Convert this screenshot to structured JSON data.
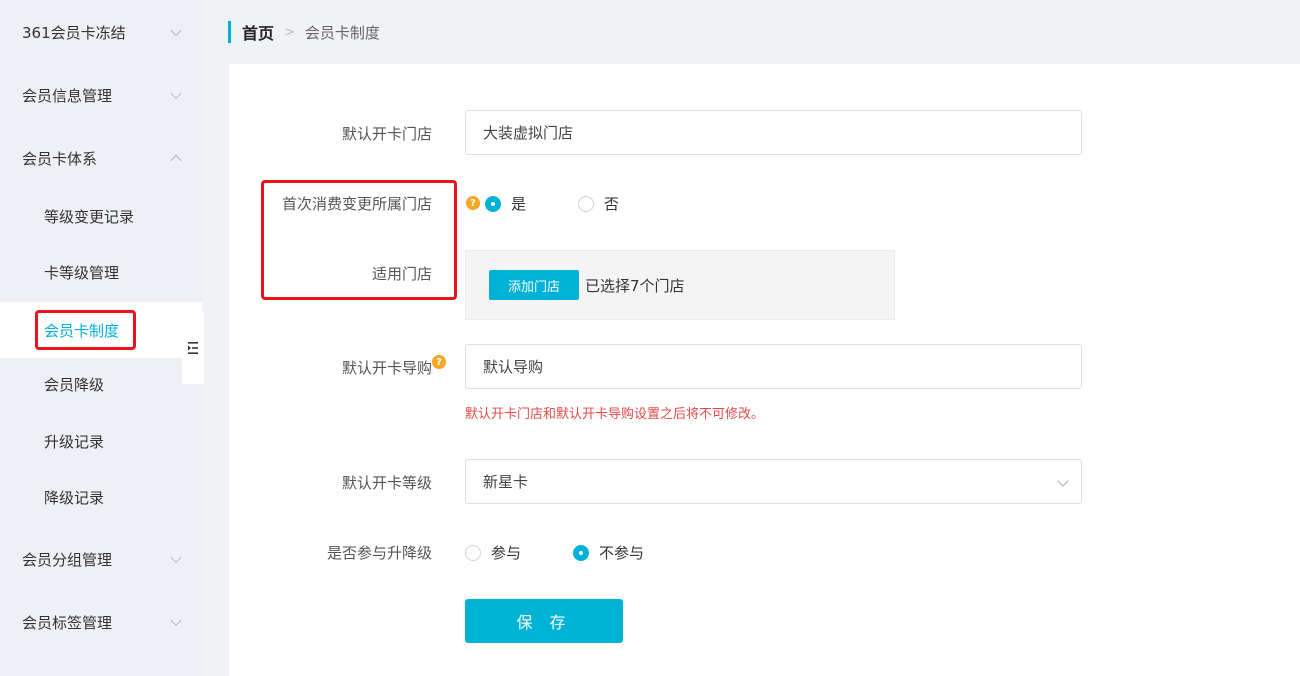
{
  "sidebar": {
    "groups": [
      {
        "label": "361会员卡冻结"
      },
      {
        "label": "会员信息管理"
      },
      {
        "label": "会员卡体系"
      },
      {
        "label": "会员分组管理"
      },
      {
        "label": "会员标签管理"
      }
    ],
    "items": [
      {
        "label": "等级变更记录"
      },
      {
        "label": "卡等级管理"
      },
      {
        "label": "会员卡制度"
      },
      {
        "label": "会员降级"
      },
      {
        "label": "升级记录"
      },
      {
        "label": "降级记录"
      }
    ]
  },
  "breadcrumb": {
    "home": "首页",
    "current": "会员卡制度"
  },
  "form": {
    "default_store": {
      "label": "默认开卡门店",
      "value": "大装虚拟门店"
    },
    "first_consume": {
      "label": "首次消费变更所属门店",
      "yes": "是",
      "no": "否",
      "selected": "yes"
    },
    "applicable_store": {
      "label": "适用门店",
      "add_button": "添加门店",
      "selected_text": "已选择7个门店"
    },
    "default_guide": {
      "label": "默认开卡导购",
      "placeholder": "默认导购",
      "warning": "默认开卡门店和默认开卡导购设置之后将不可修改。"
    },
    "default_level": {
      "label": "默认开卡等级",
      "value": "新星卡"
    },
    "upgrade": {
      "label": "是否参与升降级",
      "yes": "参与",
      "no": "不参与",
      "selected": "no"
    },
    "save_label": "保 存"
  },
  "colors": {
    "accent": "#00b3d6",
    "highlight": "#e8141b",
    "warning": "#e64a4a",
    "help": "#f5a623"
  },
  "icons": {
    "help": "question-circle-icon",
    "chevron": "chevron-down-icon",
    "collapse": "menu-collapse-icon"
  }
}
